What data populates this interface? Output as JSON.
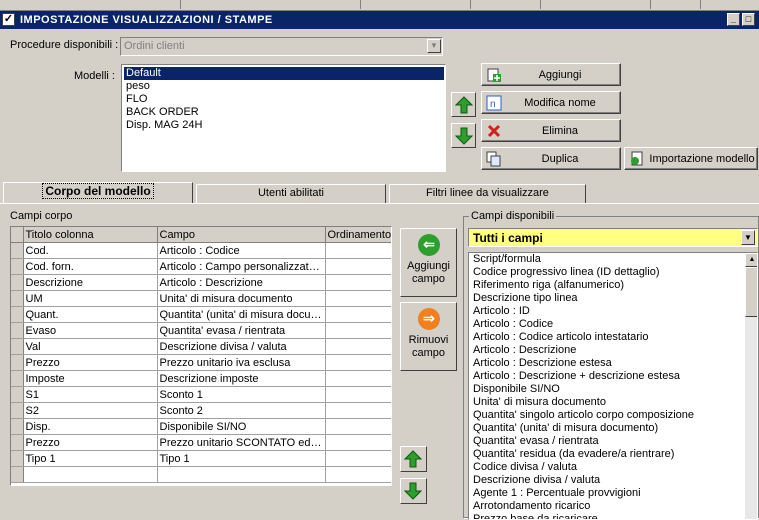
{
  "window": {
    "title": "IMPOSTAZIONE VISUALIZZAZIONI / STAMPE",
    "min_label": "_",
    "max_label": "□"
  },
  "procedure": {
    "label": "Procedure disponibili :",
    "value": "Ordini clienti"
  },
  "modelli": {
    "label": "Modelli :",
    "items": [
      "Default",
      "peso",
      "FLO",
      "BACK ORDER",
      "Disp. MAG 24H"
    ],
    "selected_index": 0
  },
  "buttons": {
    "aggiungi": "Aggiungi",
    "modifica_nome": "Modifica nome",
    "elimina": "Elimina",
    "duplica": "Duplica",
    "importazione": "Importazione modello"
  },
  "tabs": [
    {
      "label": "Corpo del modello",
      "active": true
    },
    {
      "label": "Utenti abilitati",
      "active": false
    },
    {
      "label": "Filtri linee da visualizzare",
      "active": false
    }
  ],
  "campi_corpo": {
    "label": "Campi corpo",
    "columns": [
      "Titolo colonna",
      "Campo",
      "Ordinamento"
    ],
    "rows": [
      [
        "Cod.",
        "Articolo : Codice",
        ""
      ],
      [
        "Cod. forn.",
        "Articolo : Campo personalizzato ...",
        ""
      ],
      [
        "Descrizione",
        "Articolo : Descrizione",
        ""
      ],
      [
        "UM",
        "Unita' di misura documento",
        ""
      ],
      [
        "Quant.",
        "Quantita' (unita' di misura docum...",
        ""
      ],
      [
        "Evaso",
        "Quantita' evasa / rientrata",
        ""
      ],
      [
        "Val",
        "Descrizione divisa / valuta",
        ""
      ],
      [
        "Prezzo",
        "Prezzo unitario iva esclusa",
        ""
      ],
      [
        "Imposte",
        "Descrizione imposte",
        ""
      ],
      [
        "S1",
        "Sconto 1",
        ""
      ],
      [
        "S2",
        "Sconto 2",
        ""
      ],
      [
        "Disp.",
        "Disponibile SI/NO",
        ""
      ],
      [
        "Prezzo",
        "Prezzo unitario SCONTATO ed I...",
        ""
      ],
      [
        "Tipo 1",
        "Tipo 1",
        ""
      ],
      [
        "",
        "",
        ""
      ]
    ]
  },
  "middle": {
    "aggiungi_campo": "Aggiungi campo",
    "rimuovi_campo": "Rimuovi campo"
  },
  "campi_disponibili": {
    "label": "Campi disponibili",
    "filter": "Tutti i campi",
    "items": [
      "Script/formula",
      "Codice progressivo linea (ID dettaglio)",
      "Riferimento riga (alfanumerico)",
      "Descrizione tipo linea",
      "Articolo : ID",
      "Articolo : Codice",
      "Articolo : Codice articolo intestatario",
      "Articolo : Descrizione",
      "Articolo : Descrizione estesa",
      "Articolo : Descrizione + descrizione estesa",
      "Disponibile SI/NO",
      "Unita' di misura documento",
      "Quantita' singolo articolo corpo composizione",
      "Quantita' (unita' di misura documento)",
      "Quantita' evasa / rientrata",
      "Quantita' residua (da evadere/a rientrare)",
      "Codice divisa / valuta",
      "Descrizione divisa / valuta",
      "Agente 1 : Percentuale provvigioni",
      "Arrotondamento ricarico",
      "Prezzo base da ricaricare"
    ]
  },
  "colors": {
    "titlebar": "#0a246a",
    "face": "#d4d0c8",
    "filter_bg": "#ffff80",
    "green": "#2e9e2e",
    "orange": "#f08020",
    "red": "#d02020"
  }
}
